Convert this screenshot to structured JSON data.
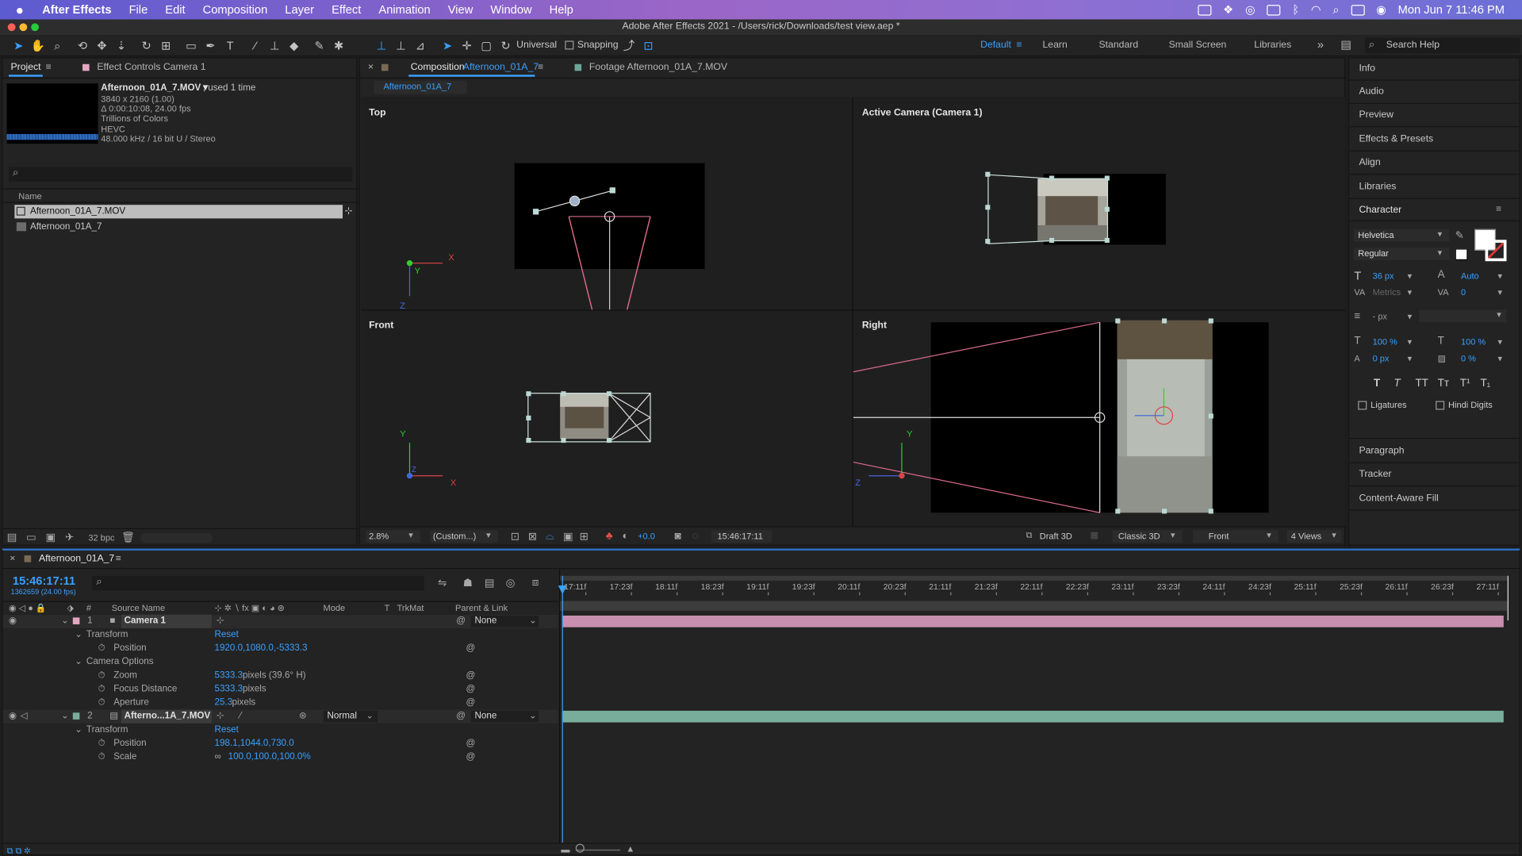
{
  "menubar": {
    "app": "After Effects",
    "items": [
      "File",
      "Edit",
      "Composition",
      "Layer",
      "Effect",
      "Animation",
      "View",
      "Window",
      "Help"
    ],
    "clock": "Mon Jun 7  11:46 PM"
  },
  "window": {
    "title": "Adobe After Effects 2021 - /Users/rick/Downloads/test view.aep *"
  },
  "toolbar": {
    "universal_label": "Universal",
    "snapping_label": "Snapping",
    "workspaces": [
      "Default",
      "Learn",
      "Standard",
      "Small Screen",
      "Libraries"
    ],
    "active_workspace": "Default",
    "search_placeholder": "Search Help"
  },
  "project": {
    "tab_label": "Project",
    "effect_tab_label": "Effect Controls Camera 1",
    "footage_name": "Afternoon_01A_7.MOV▼",
    "used_text": ", used 1 time",
    "info_lines": [
      "3840 x 2160 (1.00)",
      "Δ 0:00:10:08, 24.00 fps",
      "Trillions of Colors",
      "HEVC",
      "48.000 kHz / 16 bit U / Stereo"
    ],
    "column_name": "Name",
    "items": [
      "Afternoon_01A_7.MOV",
      "Afternoon_01A_7"
    ],
    "bpc": "32 bpc"
  },
  "comp": {
    "tab_prefix": "Composition",
    "tab_name": "Afternoon_01A_7",
    "footage_tab": "Footage Afternoon_01A_7.MOV",
    "breadcrumb": "Afternoon_01A_7",
    "views": [
      "Top",
      "Active Camera (Camera 1)",
      "Front",
      "Right"
    ],
    "zoom": "2.8%",
    "resolution": "(Custom...)",
    "exposure": "+0.0",
    "timecode": "15:46:17:11",
    "draft3d": "Draft 3D",
    "renderer": "Classic 3D",
    "view_select": "Front",
    "layout_select": "4 Views"
  },
  "right_panels": {
    "top_items": [
      "Info",
      "Audio",
      "Preview",
      "Effects & Presets",
      "Align",
      "Libraries"
    ],
    "character": {
      "title": "Character",
      "font": "Helvetica",
      "style": "Regular",
      "size": "36 px",
      "leading": "Auto",
      "kerning": "Metrics",
      "tracking": "0",
      "stroke": "- px",
      "vscale": "100 %",
      "hscale": "100 %",
      "baseline": "0 px",
      "tsume": "0 %",
      "ligatures": "Ligatures",
      "hindi": "Hindi Digits",
      "style_buttons": [
        "T",
        "T",
        "TT",
        "Tт",
        "T¹",
        "T₁"
      ]
    },
    "bottom_items": [
      "Paragraph",
      "Tracker",
      "Content-Aware Fill"
    ]
  },
  "timeline": {
    "tab_label": "Afternoon_01A_7",
    "timecode": "15:46:17:11",
    "frame_info": "1362659 (24.00 fps)",
    "col_source": "Source Name",
    "col_mode": "Mode",
    "col_t": "T",
    "col_trkmat": "TrkMat",
    "col_parent": "Parent & Link",
    "ruler": [
      "17:11f",
      "17:23f",
      "18:11f",
      "18:23f",
      "19:11f",
      "19:23f",
      "20:11f",
      "20:23f",
      "21:11f",
      "21:23f",
      "22:11f",
      "22:23f",
      "23:11f",
      "23:23f",
      "24:11f",
      "24:23f",
      "25:11f",
      "25:23f",
      "26:11f",
      "26:23f",
      "27:11f"
    ],
    "layer1": {
      "num": "1",
      "name": "Camera 1",
      "parent": "None"
    },
    "transform_label": "Transform",
    "reset_label": "Reset",
    "cam_position_label": "Position",
    "cam_position_value": "1920.0,1080.0,-5333.3",
    "camera_options_label": "Camera Options",
    "zoom_label": "Zoom",
    "zoom_value": "5333.3",
    "zoom_suffix": "pixels (39.6° H)",
    "focus_label": "Focus Distance",
    "focus_value": "5333.3",
    "focus_suffix": "pixels",
    "aperture_label": "Aperture",
    "aperture_value": "25.3",
    "aperture_suffix": "pixels",
    "layer2": {
      "num": "2",
      "name": "Afterno...1A_7.MOV",
      "mode": "Normal",
      "parent": "None"
    },
    "l2_position_label": "Position",
    "l2_position_value": "198.1,1044.0,730.0",
    "scale_label": "Scale",
    "scale_value": "100.0,100.0,100.0%"
  },
  "colors": {
    "accent": "#3aa0ff",
    "camera_bar": "#c98fae",
    "footage_bar": "#78ad9c"
  }
}
